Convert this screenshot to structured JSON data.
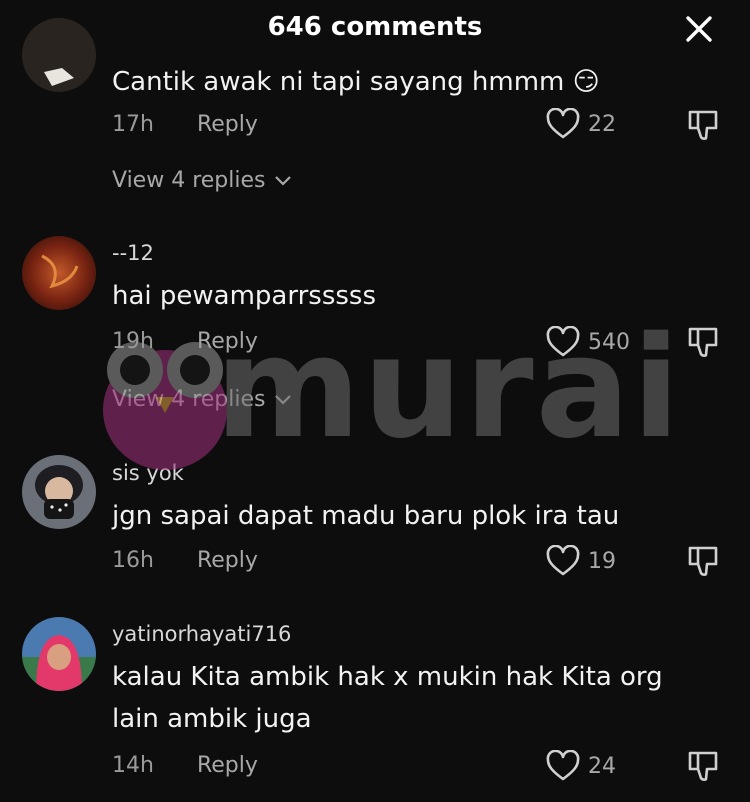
{
  "header": {
    "title": "646 comments",
    "close_icon": "close-icon"
  },
  "watermark": {
    "text": "murai",
    "accent": "#a3337f"
  },
  "comments": [
    {
      "user": "",
      "text": "Cantik awak ni tapi sayang hmmm 😏",
      "time": "17h",
      "reply_label": "Reply",
      "likes": "22",
      "view_replies": "View 4 replies"
    },
    {
      "user": "--12",
      "text": "hai pewamparrsssss",
      "time": "19h",
      "reply_label": "Reply",
      "likes": "540",
      "view_replies": "View 4 replies"
    },
    {
      "user": "sis yok",
      "text": "jgn sapai dapat madu baru plok ira tau",
      "time": "16h",
      "reply_label": "Reply",
      "likes": "19"
    },
    {
      "user": "yatinorhayati716",
      "text": "kalau Kita ambik hak x mukin hak Kita org lain ambik juga",
      "time": "14h",
      "reply_label": "Reply",
      "likes": "24"
    }
  ],
  "colors": {
    "background": "#0d0d0d",
    "text": "#f2f2f2",
    "muted": "#a8a8a8"
  }
}
